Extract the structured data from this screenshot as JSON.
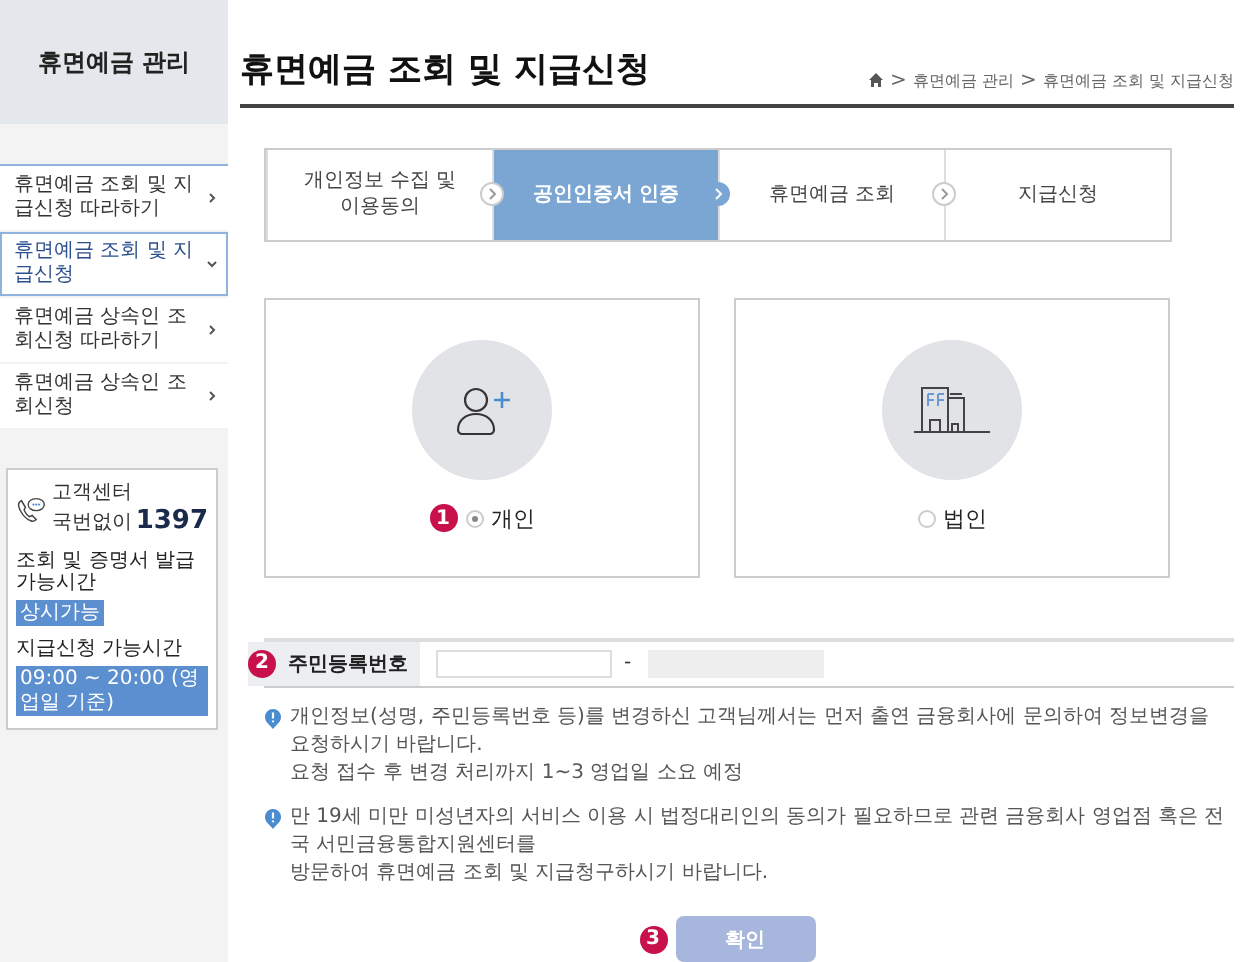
{
  "sidebar": {
    "title": "휴면예금 관리",
    "menu": [
      {
        "label": "휴면예금 조회 및 지급신청 따라하기",
        "selected": false
      },
      {
        "label": "휴면예금 조회 및 지급신청",
        "selected": true
      },
      {
        "label": "휴면예금 상속인 조회신청 따라하기",
        "selected": false
      },
      {
        "label": "휴면예금 상속인 조회신청",
        "selected": false
      }
    ],
    "contact": {
      "label": "고객센터",
      "number_label": "국번없이",
      "number": "1397",
      "hours": [
        {
          "label": "조회 및 증명서 발급 가능시간",
          "value": "상시가능"
        },
        {
          "label": "지급신청 가능시간",
          "value": "09:00 ~ 20:00 (영업일 기준)"
        }
      ]
    }
  },
  "page": {
    "title": "휴면예금 조회 및 지급신청",
    "breadcrumb": [
      ">",
      "휴면예금 관리",
      ">",
      "휴면예금 조회 및 지급신청"
    ]
  },
  "steps": [
    {
      "label": "개인정보 수집 및 이용동의",
      "selected": false
    },
    {
      "label": "공인인증서 인증",
      "selected": true
    },
    {
      "label": "휴면예금 조회",
      "selected": false
    },
    {
      "label": "지급신청",
      "selected": false
    }
  ],
  "member_types": [
    {
      "kind": "person",
      "label": "개인",
      "selected": true,
      "badge": "1"
    },
    {
      "kind": "company",
      "label": "법인",
      "selected": false
    }
  ],
  "resident_number": {
    "badge": "2",
    "label": "주민등록번호",
    "separator": "-",
    "fields": [
      {
        "disabled": false
      },
      {
        "disabled": true
      }
    ]
  },
  "notes": [
    {
      "lines": [
        "개인정보(성명, 주민등록번호 등)를 변경하신 고객님께서는 먼저 출연 금융회사에 문의하여 정보변경을 요청하시기 바랍니다.",
        "요청 접수 후 변경 처리까지 1~3 영업일 소요 예정"
      ]
    },
    {
      "lines": [
        "만 19세 미만 미성년자의 서비스 이용 시 법정대리인의 동의가 필요하므로 관련 금융회사 영업점 혹은 전국 서민금융통합지원센터를",
        "방문하여 휴면예금 조회 및 지급청구하시기 바랍니다."
      ]
    }
  ],
  "confirm": {
    "badge": "3",
    "label": "확인",
    "disabled": true
  }
}
